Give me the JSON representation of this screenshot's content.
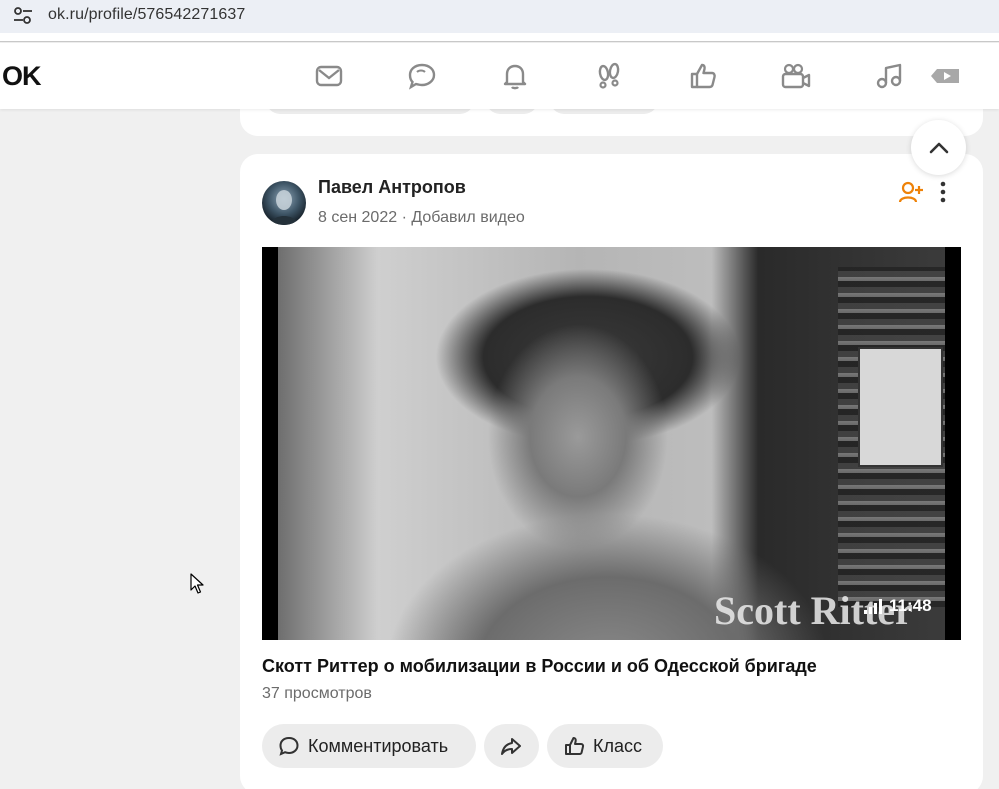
{
  "browser": {
    "url": "ok.ru/profile/576542271637",
    "site_icon": "site-settings-icon"
  },
  "header": {
    "logo": "OK",
    "nav": [
      {
        "name": "messages-icon"
      },
      {
        "name": "discussions-icon"
      },
      {
        "name": "notifications-icon"
      },
      {
        "name": "guests-icon"
      },
      {
        "name": "events-icon"
      },
      {
        "name": "video-icon"
      },
      {
        "name": "music-icon"
      },
      {
        "name": "video-playlist-icon"
      }
    ]
  },
  "post": {
    "author": "Павел Антропов",
    "date": "8 сен 2022",
    "meta_sep": "·",
    "action": "Добавил видео",
    "video": {
      "watermark": "Scott Ritter",
      "duration": "11:48"
    },
    "title": "Скотт Риттер о мобилизации в России и об Одесской бригаде",
    "views": "37 просмотров",
    "buttons": {
      "comment": "Комментировать",
      "like": "Класс"
    }
  },
  "colors": {
    "accent": "#ee8208",
    "card": "#ffffff",
    "background": "#f0f0f0",
    "button": "#ececec"
  }
}
